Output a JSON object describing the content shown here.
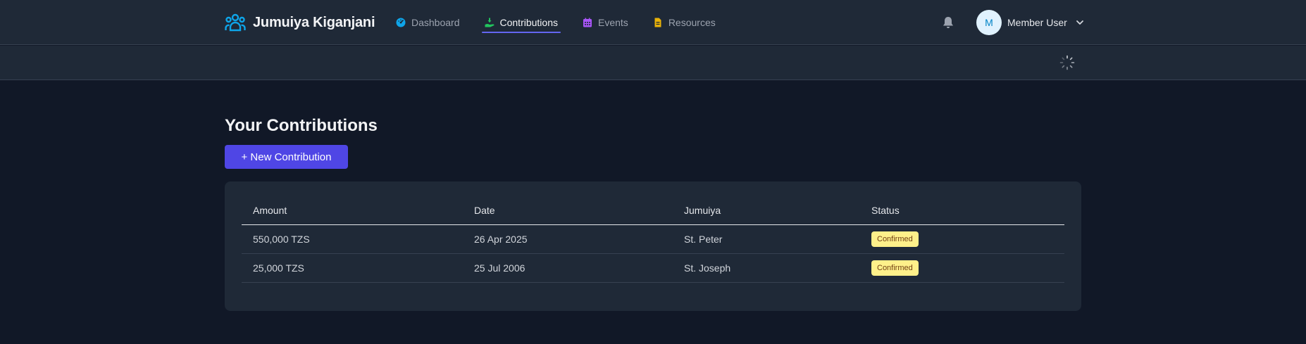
{
  "brand": {
    "name": "Jumuiya Kiganjani",
    "icon": "people-group-icon",
    "color": "#0ea5e9"
  },
  "nav": [
    {
      "label": "Dashboard",
      "icon": "gauge-icon",
      "color": "#0ea5e9",
      "active": false
    },
    {
      "label": "Contributions",
      "icon": "hand-holding-dollar-icon",
      "color": "#22c55e",
      "active": true
    },
    {
      "label": "Events",
      "icon": "calendar-icon",
      "color": "#a855f7",
      "active": false
    },
    {
      "label": "Resources",
      "icon": "document-icon",
      "color": "#eab308",
      "active": false
    }
  ],
  "header": {
    "notifications_icon": "bell-icon",
    "user": {
      "initial": "M",
      "name": "Member User"
    }
  },
  "page": {
    "title": "Your Contributions",
    "new_button": "+ New Contribution"
  },
  "table": {
    "columns": [
      "Amount",
      "Date",
      "Jumuiya",
      "Status"
    ],
    "rows": [
      {
        "amount": "550,000 TZS",
        "date": "26 Apr 2025",
        "jumuiya": "St. Peter",
        "status": "Confirmed"
      },
      {
        "amount": "25,000 TZS",
        "date": "25 Jul 2006",
        "jumuiya": "St. Joseph",
        "status": "Confirmed"
      }
    ]
  },
  "colors": {
    "accent": "#4f46e5",
    "background": "#111827",
    "surface": "#1f2937",
    "status_confirmed": "#fef08a"
  }
}
